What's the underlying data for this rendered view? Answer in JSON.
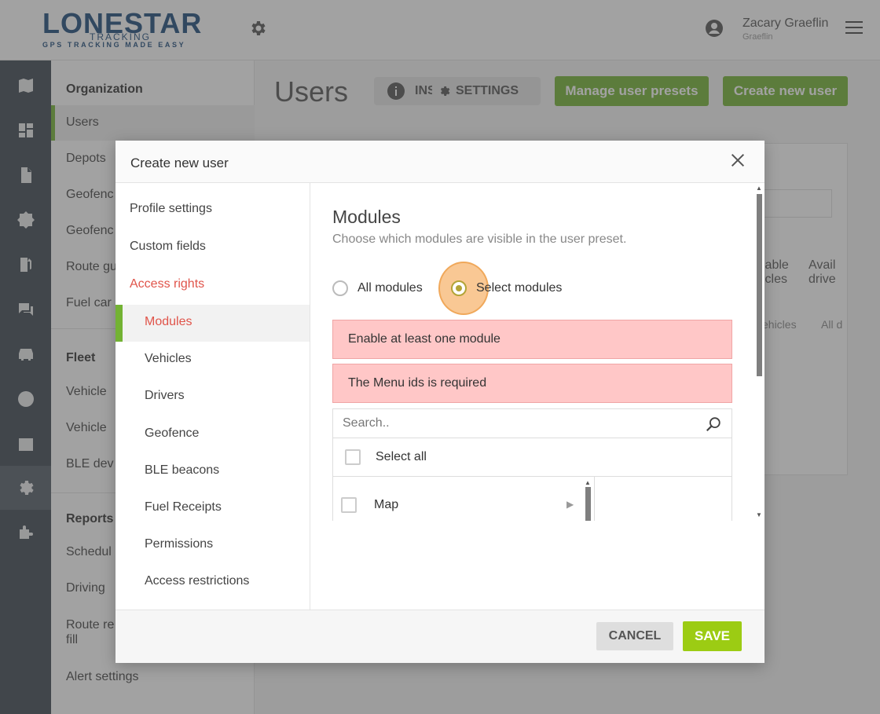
{
  "brand": {
    "logo_main": "LONESTAR",
    "logo_mid": "TRACKING",
    "logo_tagline": "GPS TRACKING MADE EASY",
    "accent_green": "#73b233",
    "save_green": "#9ccc13",
    "error_pink": "#ffc7c7"
  },
  "topbar": {
    "user_name": "Zacary Graeflin",
    "user_sub": "Graeflin"
  },
  "sidenav": {
    "sections": [
      {
        "title": "Organization",
        "items": [
          "Users",
          "Depots",
          "Geofenc",
          "Geofenc",
          "Route gu",
          "Fuel car"
        ]
      },
      {
        "title": "Fleet",
        "items": [
          "Vehicle",
          "Vehicle",
          "BLE dev"
        ]
      },
      {
        "title": "Reports",
        "items": [
          "Schedul",
          "Driving",
          "Route re fill",
          "Alert settings"
        ]
      }
    ],
    "route_line2": "fill"
  },
  "page": {
    "title": "Users",
    "info_label": "INS",
    "settings_label": "SETTINGS",
    "manage_presets_label": "Manage user presets",
    "create_user_label": "Create new user",
    "bg_col1": "lable",
    "bg_col1b": "icles",
    "bg_col2": "Avail",
    "bg_col2b": "drive",
    "bg_cell1": "ehicles",
    "bg_cell2": "All d"
  },
  "modal": {
    "title": "Create new user",
    "nav": {
      "profile_settings": "Profile settings",
      "custom_fields": "Custom fields",
      "access_rights": "Access rights",
      "subitems": [
        "Modules",
        "Vehicles",
        "Drivers",
        "Geofence",
        "BLE beacons",
        "Fuel Receipts",
        "Permissions",
        "Access restrictions"
      ]
    },
    "content": {
      "heading": "Modules",
      "description": "Choose which modules are visible in the user preset.",
      "option_all": "All modules",
      "option_select": "Select modules",
      "selected_option": "Select modules",
      "errors": [
        "Enable at least one module",
        "The Menu ids is required"
      ],
      "search_placeholder": "Search..",
      "select_all_label": "Select all",
      "modules": [
        "Map"
      ]
    },
    "footer": {
      "cancel_label": "CANCEL",
      "save_label": "SAVE"
    }
  }
}
